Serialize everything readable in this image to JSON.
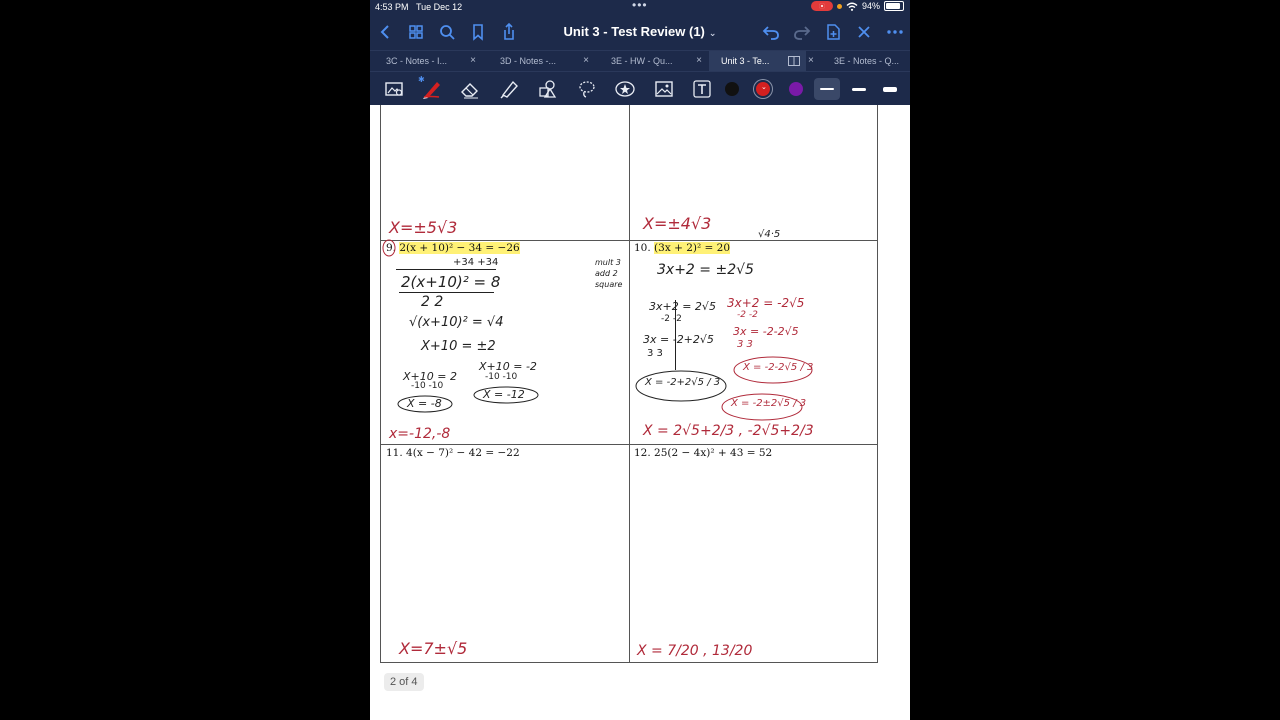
{
  "status_bar": {
    "time": "4:53 PM",
    "date": "Tue Dec 12",
    "battery": "94%"
  },
  "nav": {
    "title": "Unit 3 - Test Review (1)"
  },
  "tabs": [
    {
      "label": "3C - Notes - I..."
    },
    {
      "label": "3D - Notes -..."
    },
    {
      "label": "3E - HW - Qu..."
    },
    {
      "label": "Unit 3 - Te...",
      "active": true
    },
    {
      "label": "3E - Notes - Q..."
    }
  ],
  "toolbar": {
    "tools": [
      "audio-visual-icon",
      "pen-icon",
      "eraser-icon",
      "highlighter-icon",
      "shapes-icon",
      "lasso-icon",
      "sticker-icon",
      "image-icon",
      "text-icon"
    ],
    "colors": [
      "#111111",
      "#d42020",
      "#7a1aa8"
    ],
    "colors_selected": 1
  },
  "problems": {
    "top_left_answer": "X=±5√3",
    "top_right_answer": "X=±4√3",
    "p9": {
      "number": "9.",
      "equation": "2(x + 10)² − 34 = −26",
      "answer": "x=-12,-8"
    },
    "p10": {
      "number": "10.",
      "equation": "(3x + 2)² = 20",
      "answer": "X = 2√5+2/3 , -2√5+2/3"
    },
    "p11": {
      "number": "11.",
      "equation": "4(x − 7)² − 42 = −22",
      "answer": "X=7±√5"
    },
    "p12": {
      "number": "12.",
      "equation": "25(2 − 4x)² + 43 = 52",
      "answer": "X = 7/20 , 13/20"
    }
  },
  "work_p9": {
    "l1": "+34   +34",
    "l2": "2(x+10)² = 8",
    "l3": "2          2",
    "l4": "√(x+10)² = √4",
    "l5": "X+10 = ±2",
    "l6a": "X+10 = 2",
    "l6b": "X+10 = -2",
    "l7a": "-10  -10",
    "l7b": "-10  -10",
    "l8a": "X = -8",
    "l8b": "X = -12"
  },
  "work_p10": {
    "side_note": "mult 3\nadd 2\nsquare",
    "sqrt_note": "√4·5",
    "l1": "3x+2 = ±2√5",
    "l2a": "3x+2 = 2√5",
    "l2b": "3x+2 = -2√5",
    "l3a": "-2      -2",
    "l3b": "-2      -2",
    "l4a": "3x = -2+2√5",
    "l4b": "3x = -2-2√5",
    "l5a": "3       3",
    "l5b": "3       3",
    "l6a": "X = -2+2√5 / 3",
    "l6b": "X = -2-2√5 / 3",
    "l7": "X = -2±2√5 / 3"
  },
  "page_indicator": "2 of 4"
}
